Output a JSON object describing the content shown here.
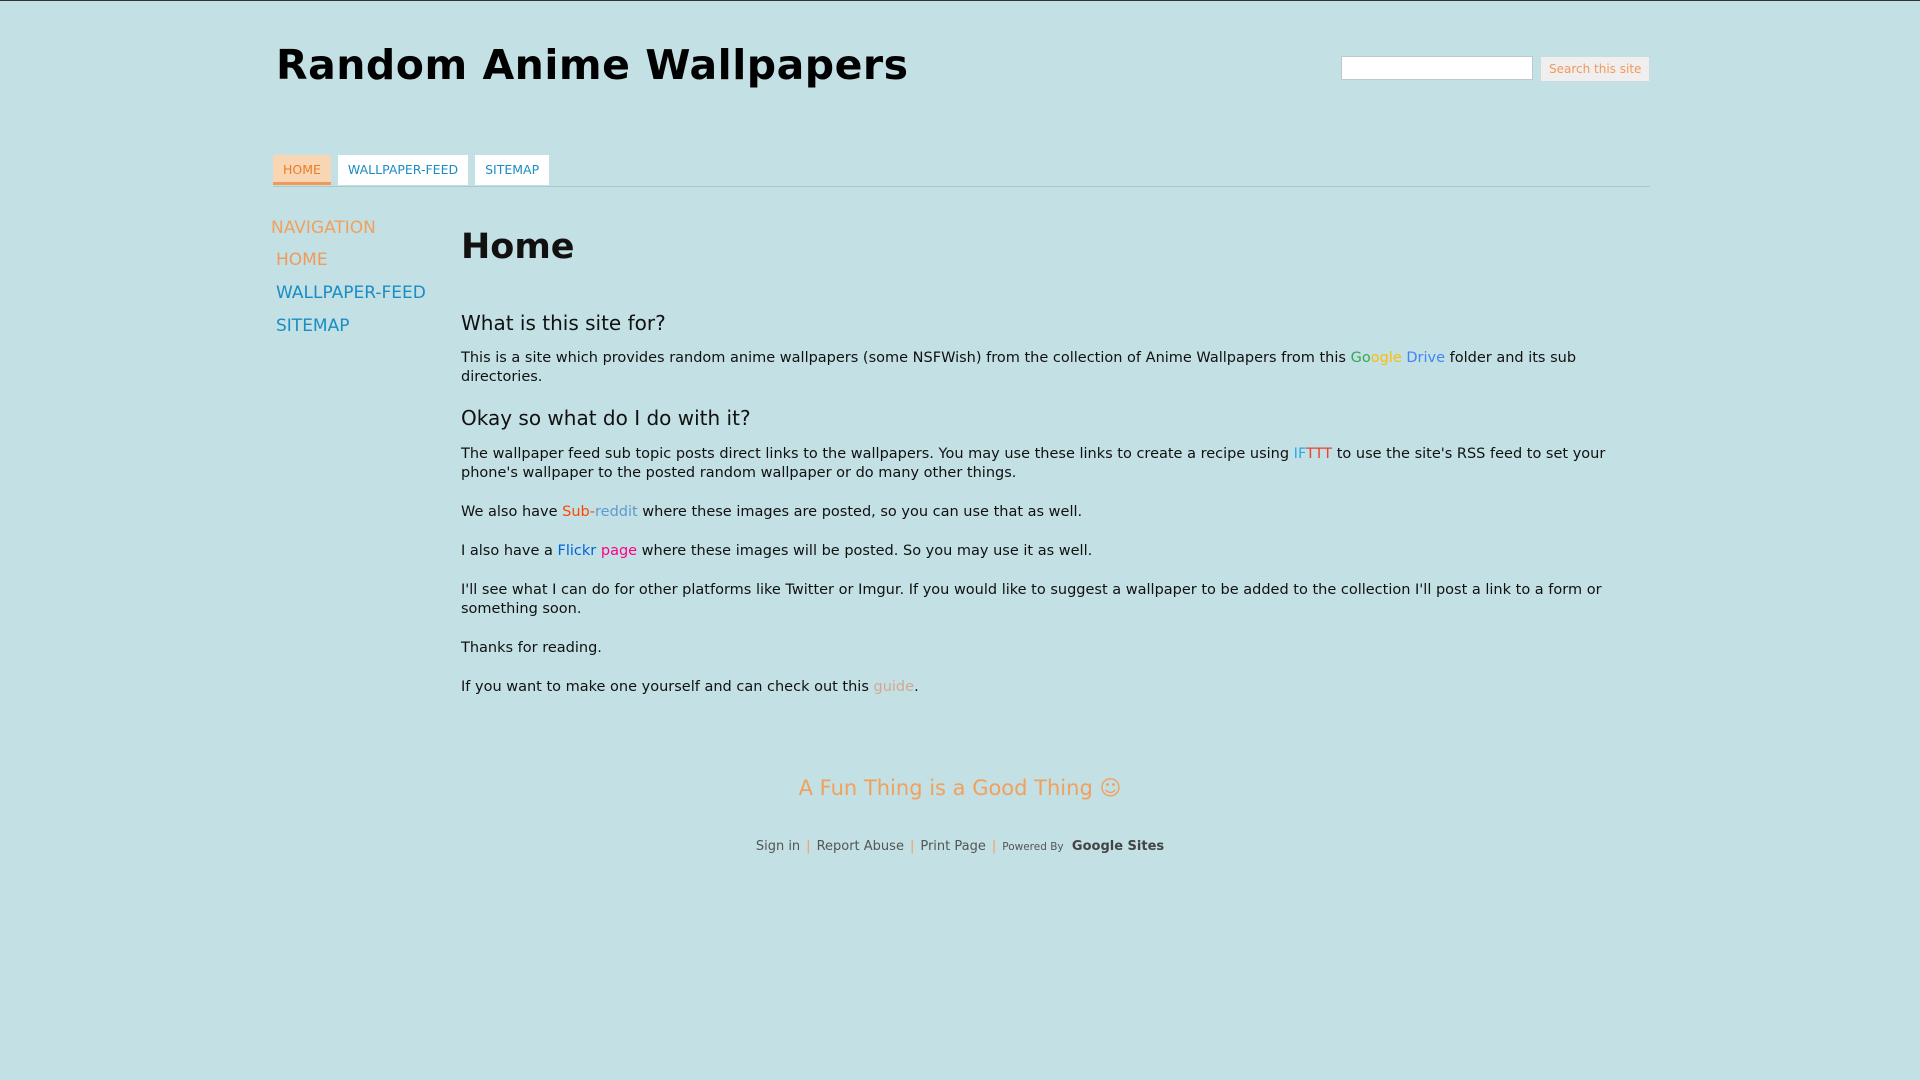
{
  "header": {
    "site_title": "Random Anime Wallpapers",
    "search_placeholder": "",
    "search_button": "Search this site"
  },
  "tabs": [
    {
      "label": "HOME",
      "active": true
    },
    {
      "label": "WALLPAPER-FEED",
      "active": false
    },
    {
      "label": "SITEMAP",
      "active": false
    }
  ],
  "sidebar": {
    "heading": "NAVIGATION",
    "items": [
      {
        "label": "HOME",
        "active": true
      },
      {
        "label": "WALLPAPER-FEED",
        "active": false
      },
      {
        "label": "SITEMAP",
        "active": false
      }
    ]
  },
  "main": {
    "title": "Home",
    "h1": "What is this site for?",
    "p1_pre": "This is a site which provides random anime wallpapers (some NSFWish) from the collection of Anime Wallpapers from this ",
    "p1_google": [
      "G",
      "o",
      "o",
      "g",
      "l",
      "e"
    ],
    "p1_drive": "Drive",
    "p1_post": " folder and its sub directories.",
    "h2": "Okay so what do I do with it?",
    "p2_pre": "The wallpaper feed sub topic posts direct links to the wallpapers. You may use these links to create a recipe using ",
    "p2_ifttt_1": "IF",
    "p2_ifttt_2": "TTT",
    "p2_post": " to use the site's RSS feed to set your phone's wallpaper to the posted random wallpaper or do many other things.",
    "p3_pre": "We also have ",
    "p3_sub": "Sub-",
    "p3_reddit": "reddit",
    "p3_post": " where these images are posted, so you can use that as well.",
    "p4_pre": "I also have a ",
    "p4_flickr": "Flickr",
    "p4_page": "page",
    "p4_post": " where these images will be posted. So you may use it as well.",
    "p5": "I'll see what I can do for other platforms like Twitter or Imgur. If you would like to suggest a wallpaper to be added to the collection I'll post a link to a form or something soon.",
    "p6": "Thanks for reading.",
    "p7_pre": "If you want to make one yourself and can check out this ",
    "p7_guide": "guide",
    "p7_post": "."
  },
  "footer": {
    "tagline": "A Fun Thing is a Good Thing ☺",
    "sign_in": "Sign in",
    "report_abuse": "Report Abuse",
    "print_page": "Print Page",
    "powered_by": "Powered By",
    "google_sites": "Google Sites",
    "separator": "|"
  },
  "colors": {
    "background": "#c3e0e4",
    "accent_orange": "#f2995a",
    "link_blue": "#1a8dc4",
    "google": [
      "#34a853",
      "#fbbc05",
      "#fbbc05",
      "#4285f4",
      "#34a853",
      "#ea4335"
    ],
    "drive_blue": "#4285f4"
  }
}
